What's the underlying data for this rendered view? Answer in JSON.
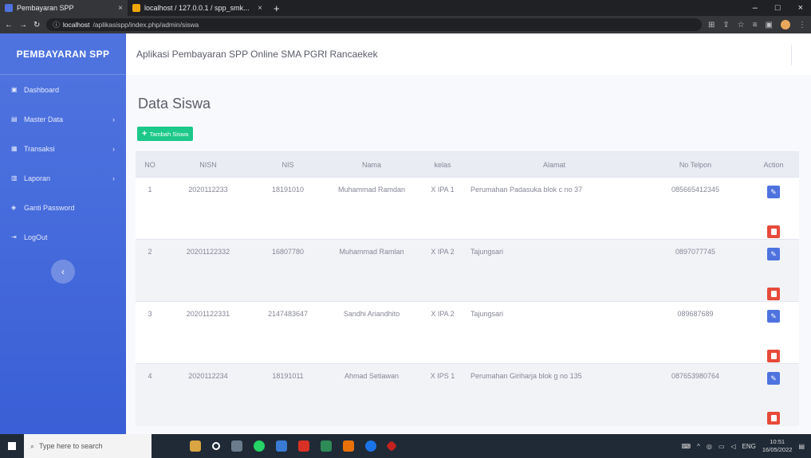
{
  "browser": {
    "tabs": [
      {
        "label": "Pembayaran SPP",
        "close": "×"
      },
      {
        "label": "localhost / 127.0.0.1 / spp_smk...",
        "close": "×"
      }
    ],
    "new_tab": "+",
    "window_controls": [
      "–",
      "□",
      "×"
    ],
    "url_host": "localhost",
    "url_path": "/aplikasispp/index.php/admin/siswa"
  },
  "sidebar": {
    "brand": "PEMBAYARAN SPP",
    "items": [
      {
        "label": "Dashboard",
        "icon": "dashboard-icon",
        "chevron": ""
      },
      {
        "label": "Master Data",
        "icon": "folder-icon",
        "chevron": "›"
      },
      {
        "label": "Transaksi",
        "icon": "table-icon",
        "chevron": "›"
      },
      {
        "label": "Laporan",
        "icon": "report-icon",
        "chevron": "›"
      },
      {
        "label": "Ganti Password",
        "icon": "lock-icon",
        "chevron": ""
      },
      {
        "label": "LogOut",
        "icon": "logout-icon",
        "chevron": ""
      }
    ],
    "toggle": "‹"
  },
  "topbar": {
    "title": "Aplikasi Pembayaran SPP Online SMA PGRI Rancaekek"
  },
  "page": {
    "title": "Data Siswa",
    "add_button": "Tambah Siswa"
  },
  "table": {
    "headers": [
      "NO",
      "NISN",
      "NIS",
      "Nama",
      "kelas",
      "Alamat",
      "No Telpon",
      "Action"
    ],
    "rows": [
      {
        "no": "1",
        "nisn": "2020112233",
        "nis": "18191010",
        "nama": "Muhammad Ramdan",
        "kelas": "X IPA 1",
        "alamat": "Perumahan Padasuka blok c no 37",
        "telp": "085665412345"
      },
      {
        "no": "2",
        "nisn": "20201122332",
        "nis": "16807780",
        "nama": "Muhammad Ramlan",
        "kelas": "X IPA 2",
        "alamat": "Tajungsari",
        "telp": "0897077745"
      },
      {
        "no": "3",
        "nisn": "20201122331",
        "nis": "2147483647",
        "nama": "Sandhi Ariandhito",
        "kelas": "X IPA 2",
        "alamat": "Tajungsari",
        "telp": "089687689"
      },
      {
        "no": "4",
        "nisn": "2020112234",
        "nis": "18191011",
        "nama": "Ahmad Setiawan",
        "kelas": "X IPS 1",
        "alamat": "Perumahan Giriharja blok g no 135",
        "telp": "087653980764"
      }
    ]
  },
  "taskbar": {
    "search_placeholder": "Type here to search",
    "lang": "ENG",
    "time": "10:51",
    "date": "16/05/2022"
  },
  "colors": {
    "primary": "#4e73df",
    "success": "#1cc88a",
    "danger": "#e74a3b"
  }
}
